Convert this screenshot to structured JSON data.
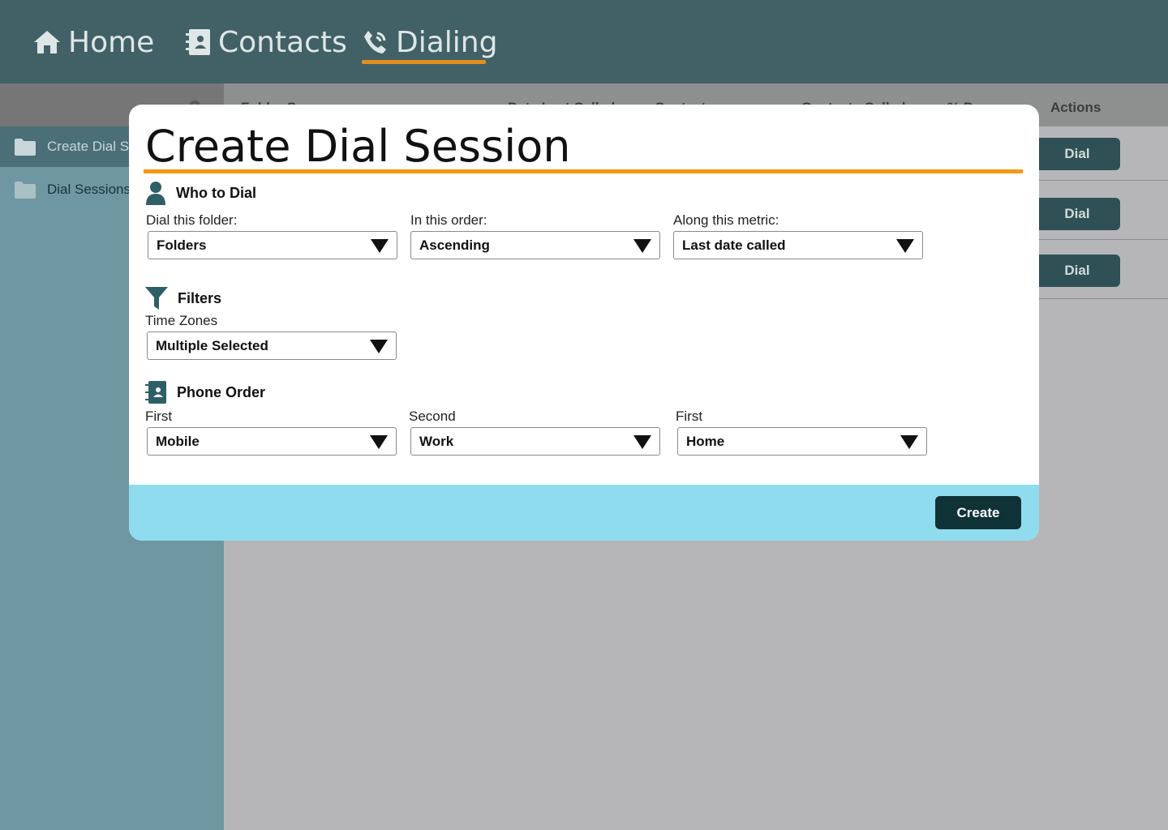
{
  "nav": {
    "home": "Home",
    "contacts": "Contacts",
    "dialing": "Dialing"
  },
  "sidebar": {
    "items": [
      {
        "label": "Create Dial S"
      },
      {
        "label": "Dial Sessions"
      }
    ]
  },
  "table": {
    "headers": [
      "Folder Source",
      "Date Last Called",
      "Contacts",
      "Contacts Called",
      "% Done",
      "Actions"
    ],
    "action_label": "Dial"
  },
  "modal": {
    "title": "Create Dial Session",
    "who": {
      "heading": "Who to Dial",
      "folder_label": "Dial this folder:",
      "folder_value": "Folders",
      "order_label": "In this order:",
      "order_value": "Ascending",
      "metric_label": "Along this metric:",
      "metric_value": "Last date called"
    },
    "filters": {
      "heading": "Filters",
      "tz_label": "Time Zones",
      "tz_value": "Multiple Selected"
    },
    "phone": {
      "heading": "Phone Order",
      "first_label": "First",
      "first_value": "Mobile",
      "second_label": "Second",
      "second_value": "Work",
      "third_label": "First",
      "third_value": "Home"
    },
    "create_label": "Create"
  },
  "colors": {
    "nav_bg": "#416166",
    "accent": "#e28f1c",
    "sidebar_bg": "#6f97a1",
    "footer_bg": "#8fdcee",
    "primary_button": "#0f3237"
  }
}
